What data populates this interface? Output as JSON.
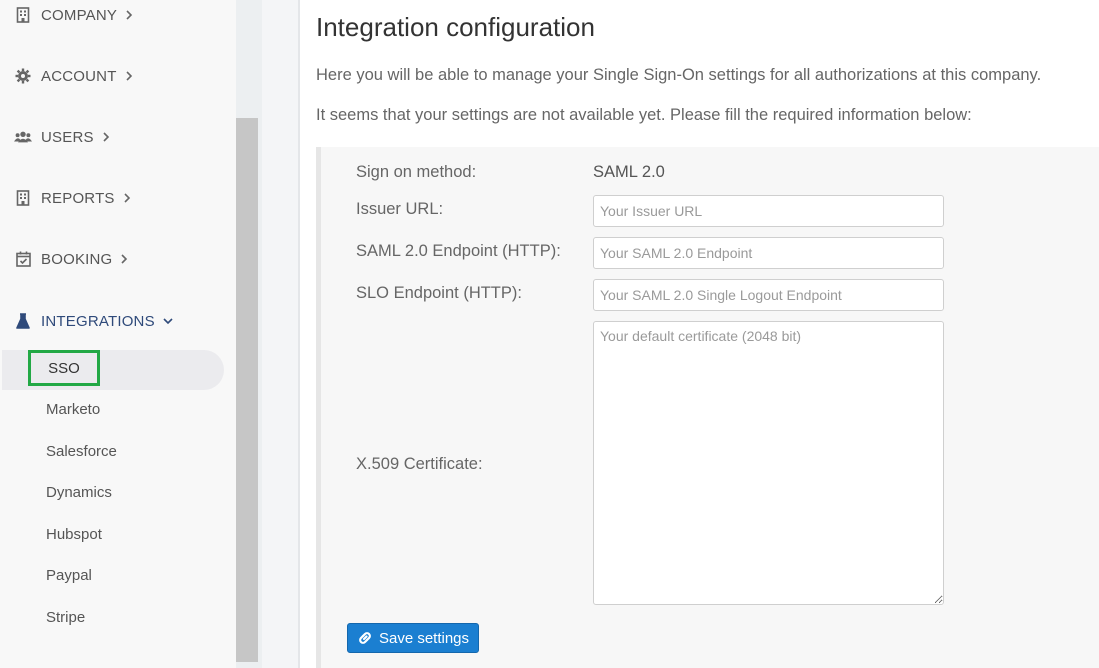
{
  "sidebar": {
    "items": [
      {
        "label": "COMPANY",
        "icon": "building-icon"
      },
      {
        "label": "ACCOUNT",
        "icon": "gear-icon"
      },
      {
        "label": "USERS",
        "icon": "users-icon"
      },
      {
        "label": "REPORTS",
        "icon": "building-icon"
      },
      {
        "label": "BOOKING",
        "icon": "calendar-check-icon"
      },
      {
        "label": "INTEGRATIONS",
        "icon": "flask-icon"
      }
    ],
    "integrations_sub": [
      "SSO",
      "Marketo",
      "Salesforce",
      "Dynamics",
      "Hubspot",
      "Paypal",
      "Stripe"
    ]
  },
  "main": {
    "title": "Integration configuration",
    "intro": "Here you will be able to manage your Single Sign-On settings for all authorizations at this company.",
    "notice": "It seems that your settings are not available yet. Please fill the required information below:",
    "form": {
      "sign_on_label": "Sign on method:",
      "sign_on_value": "SAML 2.0",
      "issuer_label": "Issuer URL:",
      "issuer_placeholder": "Your Issuer URL",
      "saml_label": "SAML 2.0 Endpoint (HTTP):",
      "saml_placeholder": "Your SAML 2.0 Endpoint",
      "slo_label": "SLO Endpoint (HTTP):",
      "slo_placeholder": "Your SAML 2.0 Single Logout Endpoint",
      "cert_label": "X.509 Certificate:",
      "cert_placeholder": "Your default certificate (2048 bit)"
    },
    "save_label": "Save settings"
  },
  "colors": {
    "accent": "#1b7fd1",
    "active_nav": "#2f4a7a",
    "highlight": "#22a845"
  }
}
